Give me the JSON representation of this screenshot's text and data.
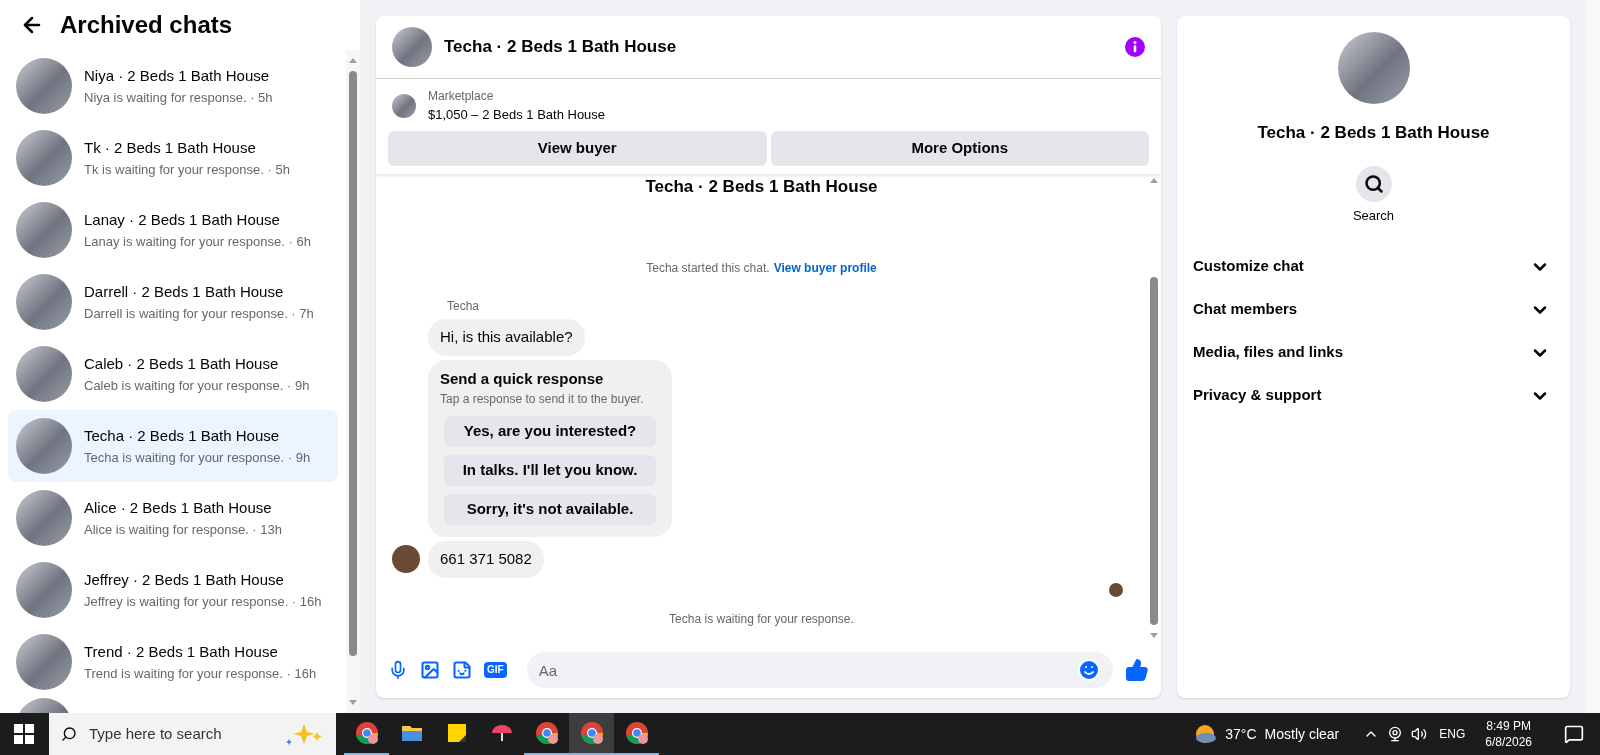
{
  "sidebar": {
    "title": "Archived chats",
    "chats": [
      {
        "name": "Niya · 2 Beds 1 Bath House",
        "preview": "Niya is waiting for response. · 5h",
        "selected": false
      },
      {
        "name": "Tk · 2 Beds 1 Bath House",
        "preview": "Tk is waiting for your response. · 5h",
        "selected": false
      },
      {
        "name": "Lanay · 2 Beds 1 Bath House",
        "preview": "Lanay is waiting for your response. · 6h",
        "selected": false
      },
      {
        "name": "Darrell · 2 Beds 1 Bath House",
        "preview": "Darrell is waiting for your response. · 7h",
        "selected": false
      },
      {
        "name": "Caleb · 2 Beds 1 Bath House",
        "preview": "Caleb is waiting for your response. · 9h",
        "selected": false
      },
      {
        "name": "Techa · 2 Beds 1 Bath House",
        "preview": "Techa is waiting for your response. · 9h",
        "selected": true
      },
      {
        "name": "Alice · 2 Beds 1 Bath House",
        "preview": "Alice is waiting for response. · 13h",
        "selected": false
      },
      {
        "name": "Jeffrey · 2 Beds 1 Bath House",
        "preview": "Jeffrey is waiting for your response. · 16h",
        "selected": false
      },
      {
        "name": "Trend · 2 Beds 1 Bath House",
        "preview": "Trend is waiting for your response. · 16h",
        "selected": false
      }
    ]
  },
  "conversation": {
    "title": "Techa · 2 Beds 1 Bath House",
    "listing": {
      "source": "Marketplace",
      "title": "$1,050 – 2 Beds 1 Bath House"
    },
    "actions": [
      "View buyer",
      "More Options"
    ],
    "thread_title": "Techa · 2 Beds 1 Bath House",
    "started": {
      "text": "Techa started this chat.",
      "link": "View buyer profile"
    },
    "sender": "Techa",
    "messages": [
      {
        "kind": "text",
        "text": "Hi, is this available?",
        "avatar": false
      },
      {
        "kind": "quick_responses",
        "title": "Send a quick response",
        "subtitle": "Tap a response to send it to the buyer.",
        "options": [
          "Yes, are you interested?",
          "In talks. I'll let you know.",
          "Sorry, it's not available."
        ]
      },
      {
        "kind": "text",
        "text": "661 371 5082",
        "avatar": true
      }
    ],
    "seen": true,
    "status": "Techa is waiting for your response.",
    "composer": {
      "placeholder": "Aa",
      "gif_label": "GIF"
    }
  },
  "details": {
    "title": "Techa · 2 Beds 1 Bath House",
    "search": "Search",
    "sections": [
      {
        "label": "Customize chat",
        "expanded": false
      },
      {
        "label": "Chat members",
        "expanded": false
      },
      {
        "label": "Media, files and links",
        "expanded": false
      },
      {
        "label": "Privacy & support",
        "expanded": false
      }
    ]
  },
  "taskbar": {
    "search_placeholder": "Type here to search",
    "apps": [
      {
        "kind": "chrome",
        "selected": false
      },
      {
        "kind": "folder",
        "selected": false
      },
      {
        "kind": "notes",
        "selected": false
      },
      {
        "kind": "umbrella",
        "selected": false
      },
      {
        "kind": "chrome",
        "selected": false
      },
      {
        "kind": "chrome",
        "selected": true
      },
      {
        "kind": "chrome",
        "selected": false
      }
    ],
    "weather": {
      "temperature": "37°C",
      "condition": "Mostly clear"
    },
    "language": "ENG",
    "time": "8:49 PM",
    "date": "6/8/2026"
  }
}
